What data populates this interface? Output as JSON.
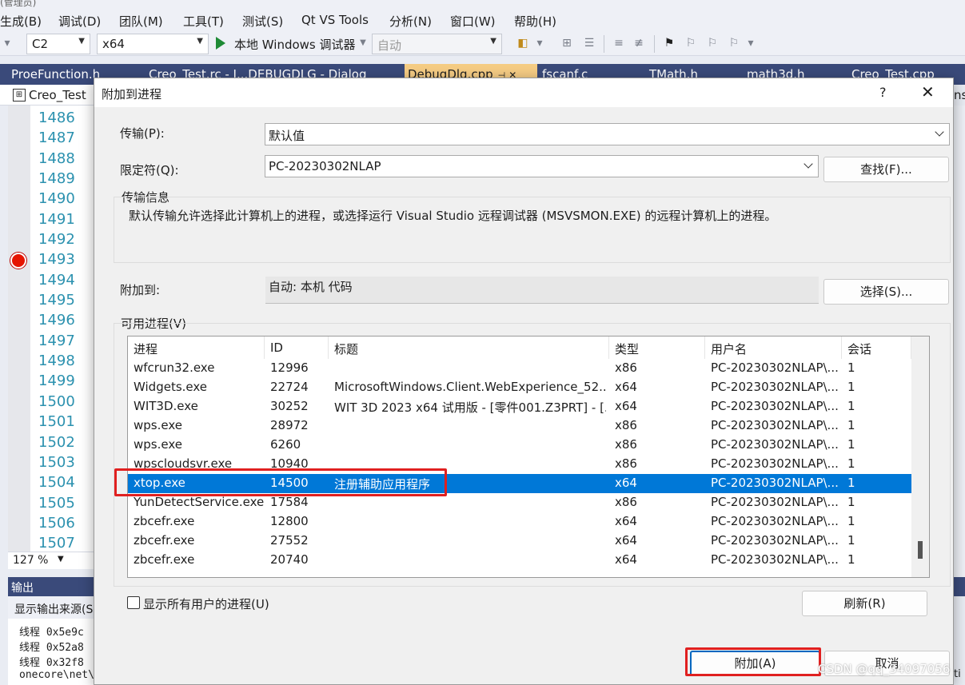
{
  "ide": {
    "title_fragment": "(管理员)",
    "menu": [
      "生成(B)",
      "调试(D)",
      "团队(M)",
      "工具(T)",
      "测试(S)",
      "Qt VS Tools",
      "分析(N)",
      "窗口(W)",
      "帮助(H)"
    ],
    "toolbar": {
      "config": "C2",
      "platform": "x64",
      "run_label": "本地 Windows 调试器",
      "run_mode": "自动"
    },
    "doc_tabs": [
      {
        "label": "ProeFunction.h"
      },
      {
        "label": "Creo_Test.rc - I...DEBUGDLG - Dialog"
      },
      {
        "label": "DebugDlg.cpp"
      },
      {
        "label": "fscanf.c"
      },
      {
        "label": "TMath.h"
      },
      {
        "label": "math3d.h"
      },
      {
        "label": "Creo_Test.cpp"
      }
    ],
    "editor_scope": "Creo_Test",
    "editor_scope_right": "ns",
    "line_numbers": [
      "1486",
      "1487",
      "1488",
      "1489",
      "1490",
      "1491",
      "1492",
      "1493",
      "1494",
      "1495",
      "1496",
      "1497",
      "1498",
      "1499",
      "1500",
      "1501",
      "1502",
      "1503",
      "1504",
      "1505",
      "1506",
      "1507"
    ],
    "zoom": "127 %",
    "output": {
      "title": "输出",
      "source_label": "显示输出来源(S)",
      "lines": [
        "线程 0x5e9c",
        "线程 0x52a8",
        "线程 0x32f8",
        "onecore\\net\\"
      ],
      "right_fragment": "ti"
    }
  },
  "dialog": {
    "title": "附加到进程",
    "help": "?",
    "transport_label": "传输(P):",
    "transport_value": "默认值",
    "qualifier_label": "限定符(Q):",
    "qualifier_value": "PC-20230302NLAP",
    "find_button": "查找(F)...",
    "transport_info_title": "传输信息",
    "transport_info_text": "默认传输允许选择此计算机上的进程，或选择运行 Visual Studio 远程调试器 (MSVSMON.EXE) 的远程计算机上的进程。",
    "attach_to_label": "附加到:",
    "attach_to_value": "自动: 本机 代码",
    "select_button": "选择(S)...",
    "available_label": "可用进程(V)",
    "columns": [
      "进程",
      "ID",
      "标题",
      "类型",
      "用户名",
      "会话"
    ],
    "processes": [
      {
        "name": "wfcrun32.exe",
        "id": "12996",
        "title": "",
        "type": "x86",
        "user": "PC-20230302NLAP\\...",
        "session": "1"
      },
      {
        "name": "Widgets.exe",
        "id": "22724",
        "title": "MicrosoftWindows.Client.WebExperience_52...",
        "type": "x64",
        "user": "PC-20230302NLAP\\...",
        "session": "1"
      },
      {
        "name": "WIT3D.exe",
        "id": "30252",
        "title": "WIT 3D 2023 x64 试用版 - [零件001.Z3PRT]  - [...",
        "type": "x64",
        "user": "PC-20230302NLAP\\...",
        "session": "1"
      },
      {
        "name": "wps.exe",
        "id": "28972",
        "title": "",
        "type": "x86",
        "user": "PC-20230302NLAP\\...",
        "session": "1"
      },
      {
        "name": "wps.exe",
        "id": "6260",
        "title": "",
        "type": "x86",
        "user": "PC-20230302NLAP\\...",
        "session": "1"
      },
      {
        "name": "wpscloudsvr.exe",
        "id": "10940",
        "title": "",
        "type": "x86",
        "user": "PC-20230302NLAP\\...",
        "session": "1"
      },
      {
        "name": "xtop.exe",
        "id": "14500",
        "title": "注册辅助应用程序",
        "type": "x64",
        "user": "PC-20230302NLAP\\...",
        "session": "1",
        "selected": true
      },
      {
        "name": "YunDetectService.exe",
        "id": "17584",
        "title": "",
        "type": "x86",
        "user": "PC-20230302NLAP\\...",
        "session": "1"
      },
      {
        "name": "zbcefr.exe",
        "id": "12800",
        "title": "",
        "type": "x64",
        "user": "PC-20230302NLAP\\...",
        "session": "1"
      },
      {
        "name": "zbcefr.exe",
        "id": "27552",
        "title": "",
        "type": "x64",
        "user": "PC-20230302NLAP\\...",
        "session": "1"
      },
      {
        "name": "zbcefr.exe",
        "id": "20740",
        "title": "",
        "type": "x64",
        "user": "PC-20230302NLAP\\...",
        "session": "1"
      }
    ],
    "show_all_users_label": "显示所有用户的进程(U)",
    "show_all_users_checked": false,
    "refresh_button": "刷新(R)",
    "attach_button": "附加(A)",
    "cancel_button": "取消"
  },
  "watermark": "CSDN @qq_34097056",
  "colors": {
    "selection": "#0078d7",
    "highlight_annotation": "#e02020",
    "doc_tab_bar": "#3a4a7a",
    "active_tab": "#f5cc84",
    "breakpoint": "#e51400",
    "line_number": "#2b91af"
  }
}
